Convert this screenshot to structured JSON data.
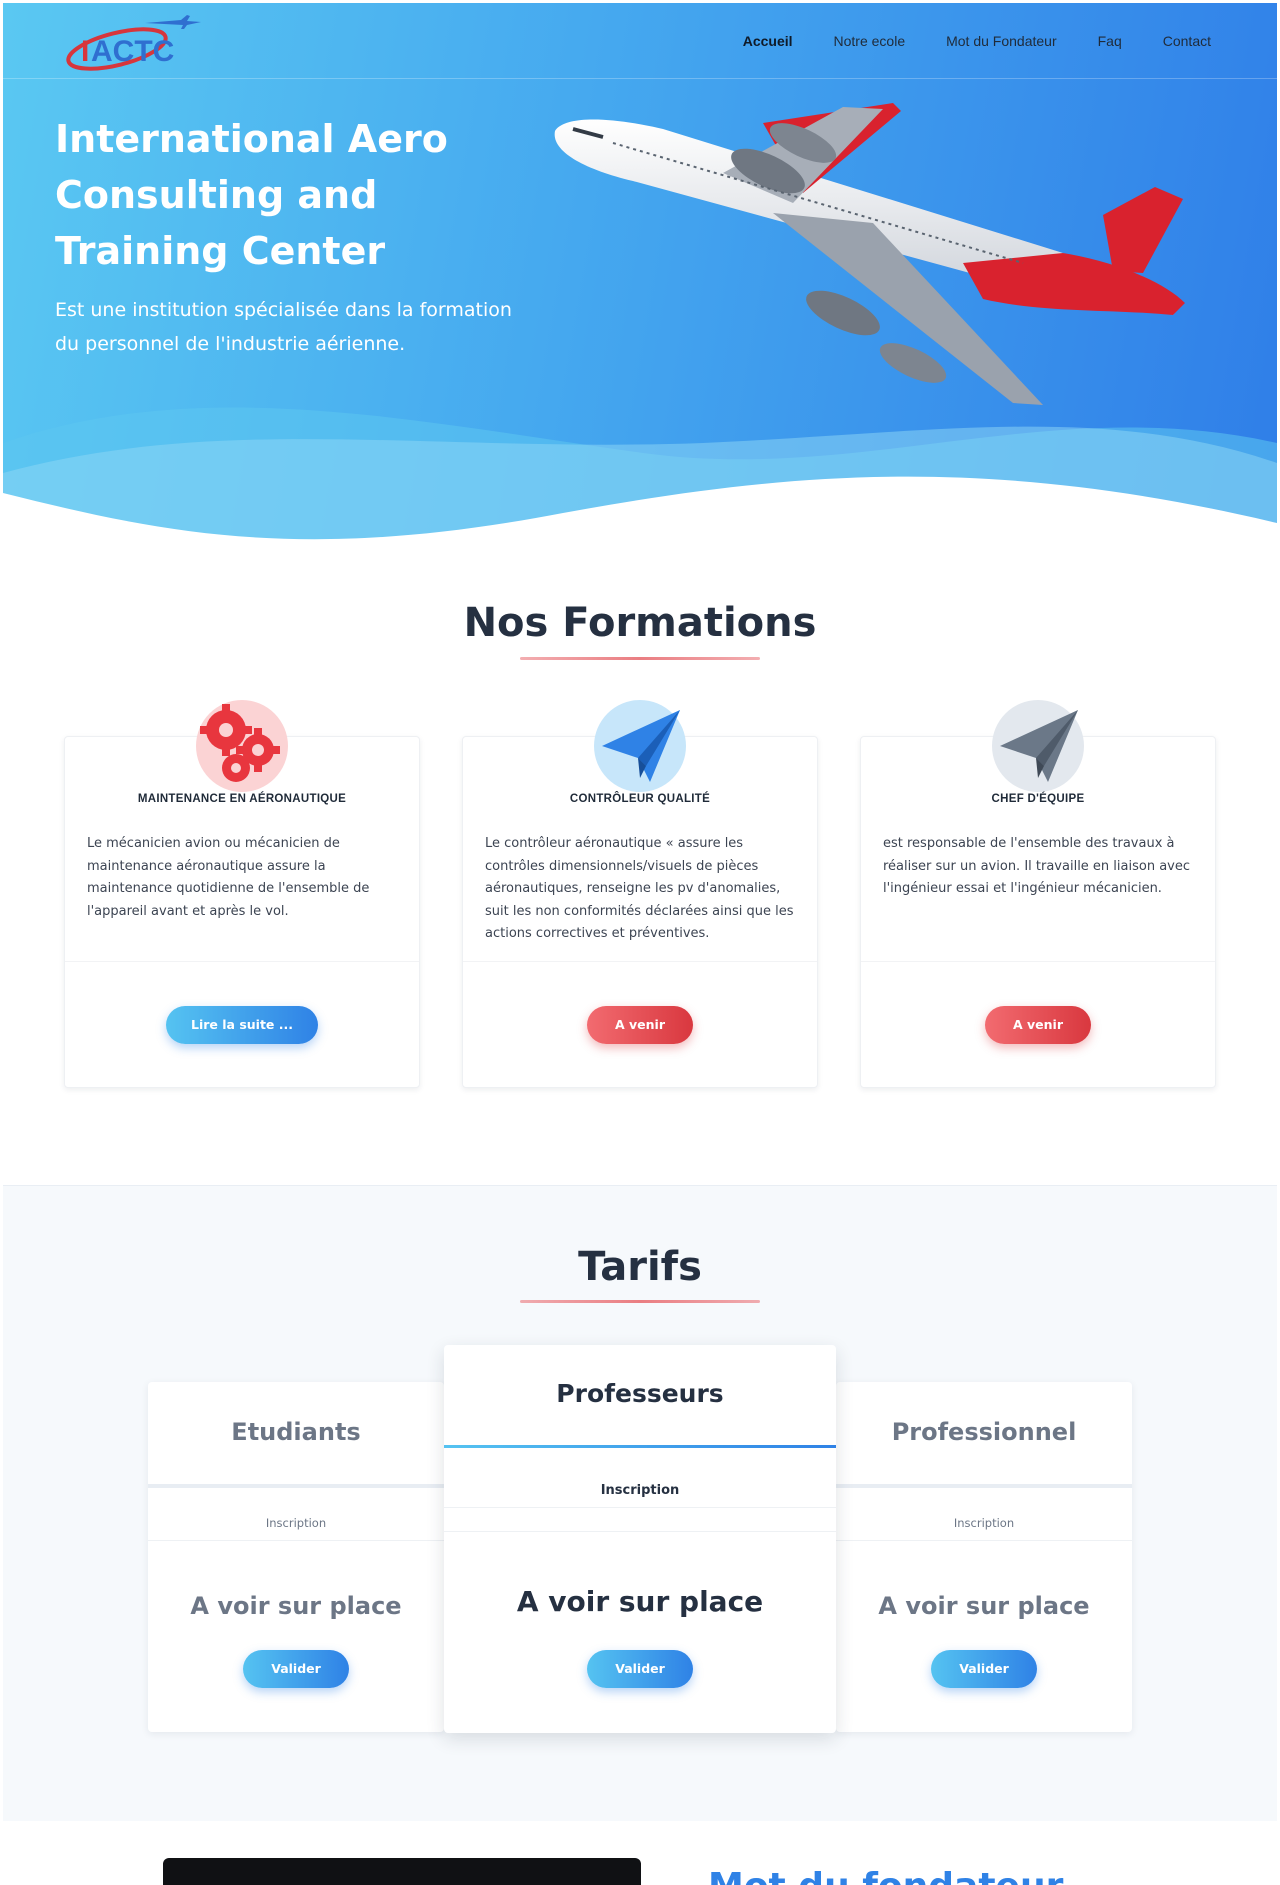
{
  "brand": {
    "logo_text": "IACTC"
  },
  "nav": {
    "items": [
      "Accueil",
      "Notre ecole",
      "Mot du Fondateur",
      "Faq",
      "Contact"
    ],
    "active": "Accueil"
  },
  "hero": {
    "title": "International Aero Consulting and Training Center",
    "subtitle": "Est une institution spécialisée dans la formation du personnel de l'industrie aérienne."
  },
  "formations": {
    "title": "Nos Formations",
    "cards": [
      {
        "icon": "gears-icon",
        "title": "MAINTENANCE EN AÉRONAUTIQUE",
        "text": "Le mécanicien avion ou mécanicien de maintenance aéronautique assure la maintenance quotidienne de l'ensemble de l'appareil avant et après le vol.",
        "button": "Lire la suite ..."
      },
      {
        "icon": "paper-plane-icon",
        "title": "CONTRÔLEUR QUALITÉ",
        "text": "Le contrôleur aéronautique « assure les contrôles dimensionnels/visuels de pièces aéronautiques, renseigne les pv d'anomalies, suit les non conformités déclarées ainsi que les actions correctives et préventives.",
        "button": "A venir"
      },
      {
        "icon": "paper-plane-icon",
        "title": "CHEF D'ÉQUIPE",
        "text": "est responsable de l'ensemble des travaux à réaliser sur un avion. Il travaille en liaison avec l'ingénieur essai et l'ingénieur mécanicien.",
        "button": "A venir"
      }
    ]
  },
  "tarifs": {
    "title": "Tarifs",
    "plans": [
      {
        "name": "Etudiants",
        "sub": "Inscription",
        "price": "A voir sur place",
        "button": "Valider"
      },
      {
        "name": "Professeurs",
        "sub": "Inscription",
        "price": "A voir sur place",
        "button": "Valider"
      },
      {
        "name": "Professionnel",
        "sub": "Inscription",
        "price": "A voir sur place",
        "button": "Valider"
      }
    ]
  },
  "founder": {
    "title": "Mot du fondateur"
  },
  "colors": {
    "accent_blue": "#2f82e6",
    "accent_red": "#d9383f",
    "hero_light": "#5ac8f2"
  }
}
